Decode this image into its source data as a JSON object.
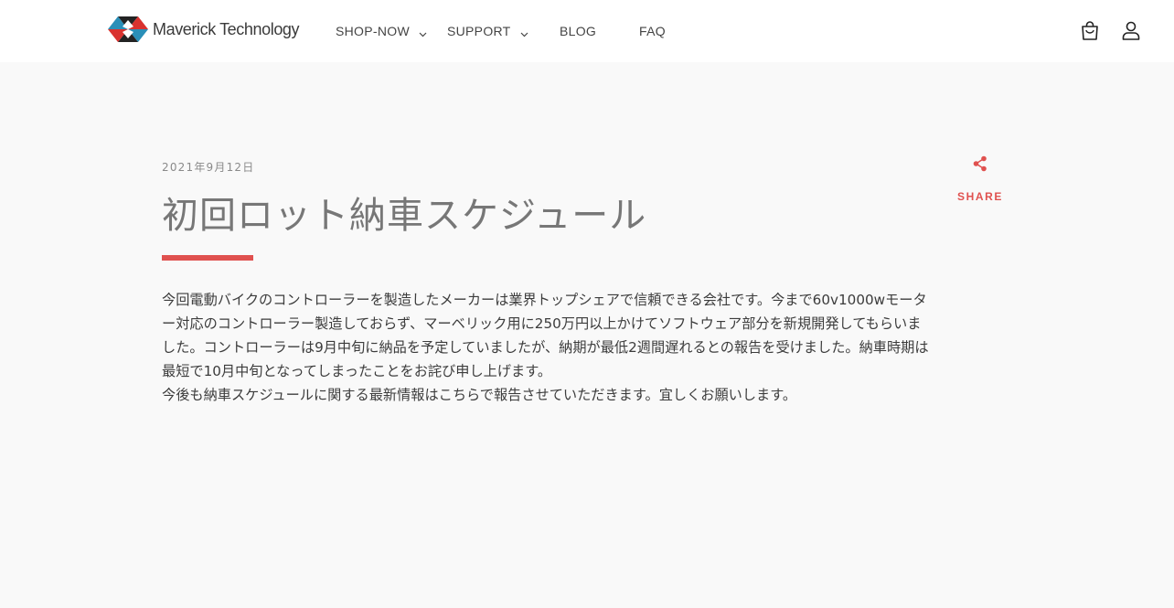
{
  "header": {
    "logo_text": "Maverick Technology",
    "nav": [
      {
        "label": "SHOP-NOW",
        "has_dropdown": true
      },
      {
        "label": "SUPPORT",
        "has_dropdown": true
      },
      {
        "label": "BLOG",
        "has_dropdown": false
      },
      {
        "label": "FAQ",
        "has_dropdown": false
      }
    ],
    "icons": [
      "cart-icon",
      "account-icon"
    ]
  },
  "article": {
    "date": "2021年9月12日",
    "title": "初回ロット納車スケジュール",
    "paragraphs": [
      "今回電動バイクのコントローラーを製造したメーカーは業界トップシェアで信頼できる会社です。今まで60v1000wモーター対応のコントローラー製造しておらず、マーベリック用に250万円以上かけてソフトウェア部分を新規開発してもらいました。コントローラーは9月中旬に納品を予定していましたが、納期が最低2週間遅れるとの報告を受けました。納車時期は最短で10月中旬となってしまったことをお詫び申し上げます。",
      "今後も納車スケジュールに関する最新情報はこちらで報告させていただきます。宜しくお願いします。"
    ]
  },
  "share": {
    "label": "SHARE",
    "icon": "share-icon"
  },
  "colors": {
    "accent": "#e0514f",
    "header_bg": "#ffffff",
    "page_bg": "#f9f9f9",
    "title_text": "#777777"
  }
}
